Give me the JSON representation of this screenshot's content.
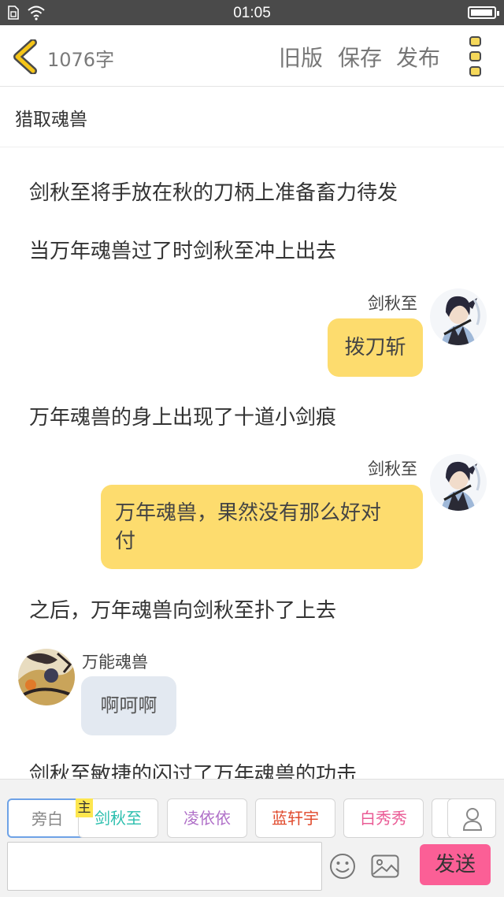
{
  "status_bar": {
    "time": "01:05",
    "battery_level": 0.95
  },
  "header": {
    "word_count": "1076字",
    "actions": {
      "old_version": "旧版",
      "save": "保存",
      "publish": "发布"
    }
  },
  "chapter": {
    "title": "猎取魂兽"
  },
  "story": {
    "n1": "剑秋至将手放在秋的刀柄上准备畜力待发",
    "n2": "当万年魂兽过了时剑秋至冲上出去",
    "m1": {
      "sender": "剑秋至",
      "text": "拨刀斩"
    },
    "n3": "万年魂兽的身上出现了十道小剑痕",
    "m2": {
      "sender": "剑秋至",
      "line1": "万年魂兽，果然没有那么好对",
      "line2": "付"
    },
    "n4": "之后，万年魂兽向剑秋至扑了上去",
    "m3": {
      "sender": "万能魂兽",
      "text": "啊呵啊"
    },
    "n5": "剑秋至敏捷的闪过了万年魂兽的功击"
  },
  "characters": [
    {
      "name": "旁白",
      "color": "#888888"
    },
    {
      "name": "剑秋至",
      "color": "#2bbfae"
    },
    {
      "name": "凌依依",
      "color": "#b070c8"
    },
    {
      "name": "蓝轩宇",
      "color": "#e04a2c"
    },
    {
      "name": "白秀秀",
      "color": "#ea5b95"
    }
  ],
  "host_tag": "主",
  "composer": {
    "input_value": "",
    "send_label": "发送"
  },
  "colors": {
    "accent_yellow": "#fddc6e",
    "send_pink": "#fb5f96",
    "bubble_blue": "#e3e9f1",
    "back_yellow": "#f5c518"
  }
}
